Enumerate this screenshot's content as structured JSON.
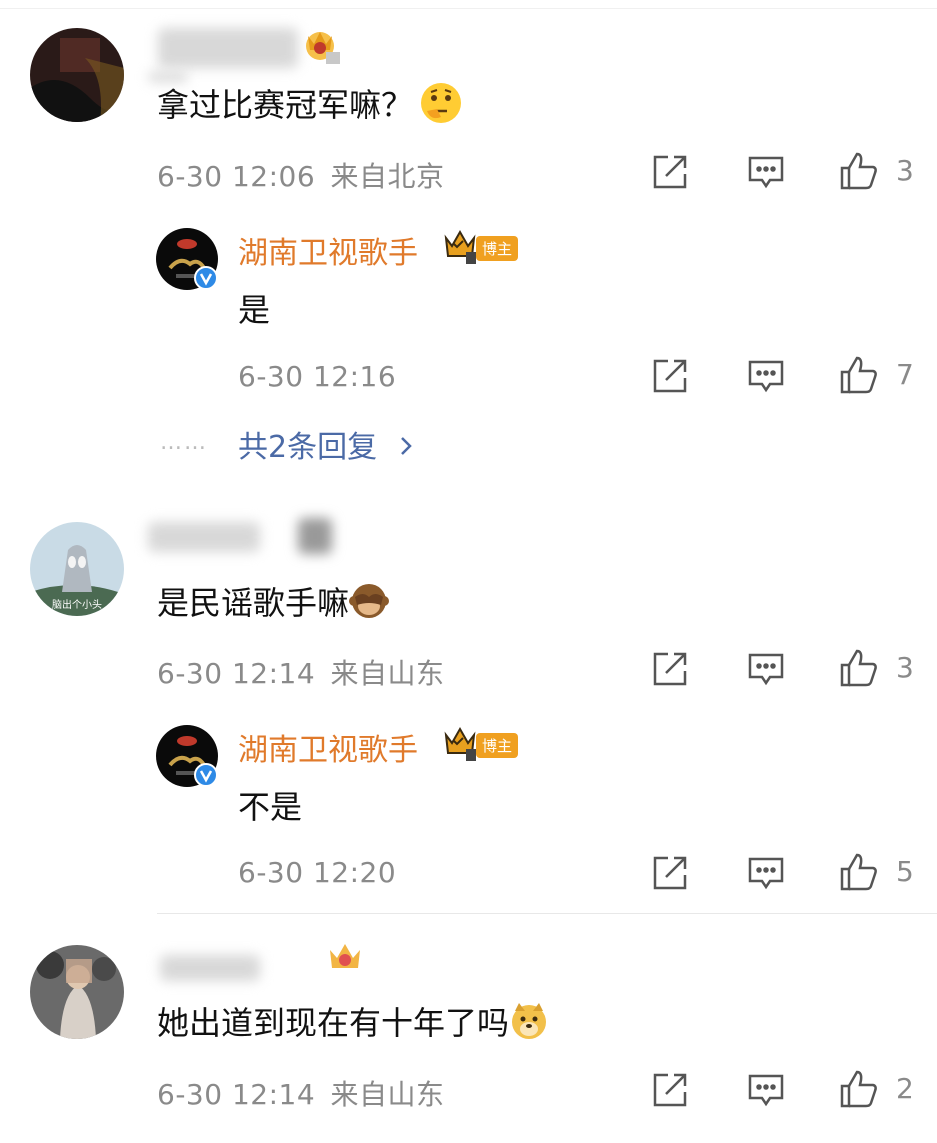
{
  "comments": [
    {
      "username_visible": "",
      "text": "拿过比赛冠军嘛？",
      "emoji_icon": "thinking-face-icon",
      "time": "6-30 12:06",
      "location": "来自北京",
      "likes": "3",
      "reply": {
        "username": "湖南卫视歌手",
        "badge": "博主",
        "text": "是",
        "time": "6-30 12:16",
        "likes": "7"
      },
      "more_replies": "共2条回复"
    },
    {
      "text": "是民谣歌手嘛",
      "emoji_icon": "see-no-evil-monkey-icon",
      "time": "6-30 12:14",
      "location": "来自山东",
      "likes": "3",
      "avatar_caption": "脑出个小头",
      "reply": {
        "username": "湖南卫视歌手",
        "badge": "博主",
        "text": "不是",
        "time": "6-30 12:20",
        "likes": "5"
      }
    },
    {
      "text": "她出道到现在有十年了吗",
      "emoji_icon": "doge-icon",
      "time": "6-30 12:14",
      "location": "来自山东",
      "likes": "2"
    }
  ],
  "dots": "……",
  "colors": {
    "accent": "#e07a2b",
    "link": "#4b6aa6",
    "meta": "#8a8a8a"
  }
}
